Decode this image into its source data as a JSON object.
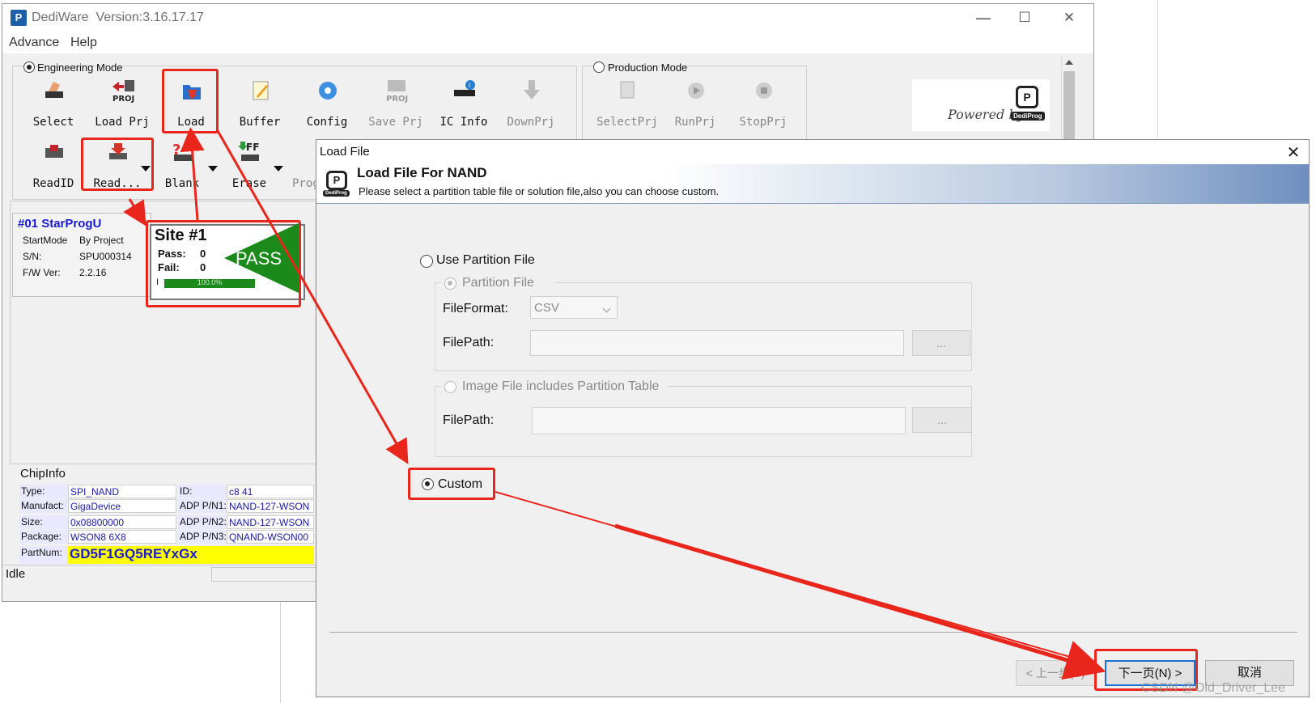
{
  "main_window": {
    "app_name": "DediWare",
    "version": "Version:3.16.17.17",
    "controls": {
      "minimize": "—",
      "maximize": "☐",
      "close": "✕"
    },
    "menu": [
      "Advance",
      "Help"
    ],
    "engineering_mode": "Engineering Mode",
    "production_mode": "Production Mode",
    "toolbar_row1": [
      "Select",
      "Load Prj",
      "Load",
      "Buffer",
      "Config",
      "Save Prj",
      "IC Info",
      "DownPrj"
    ],
    "toolbar_row2": [
      "ReadID",
      "Read...",
      "Blank",
      "Erase",
      "Prog"
    ],
    "production_tools": [
      "SelectPrj",
      "RunPrj",
      "StopPrj"
    ],
    "powered_by": "Powered by",
    "brand": "DediProg"
  },
  "programmer": {
    "title": "#01 StarProgU",
    "fields": [
      {
        "label": "StartMode",
        "value": "By Project"
      },
      {
        "label": "S/N:",
        "value": "SPU000314"
      },
      {
        "label": "F/W Ver:",
        "value": "2.2.16"
      }
    ]
  },
  "site": {
    "title": "Site #1",
    "pass_label": "Pass:",
    "pass_value": "0",
    "fail_label": "Fail:",
    "fail_value": "0",
    "result": "PASS",
    "progress_marker": "I",
    "progress_text": "100.0%",
    "progress": 1.0
  },
  "chip_info": {
    "title": "ChipInfo",
    "left": [
      {
        "label": "Type:",
        "value": "SPI_NAND"
      },
      {
        "label": "Manufact:",
        "value": "GigaDevice"
      },
      {
        "label": "Size:",
        "value": "0x08800000"
      },
      {
        "label": "Package:",
        "value": "WSON8 6X8"
      }
    ],
    "right": [
      {
        "label": "ID:",
        "value": "c8 41"
      },
      {
        "label": "ADP P/N1:",
        "value": "NAND-127-WSON"
      },
      {
        "label": "ADP P/N2:",
        "value": "NAND-127-WSON"
      },
      {
        "label": "ADP P/N3:",
        "value": "QNAND-WSON00"
      }
    ],
    "partnum_label": "PartNum:",
    "partnum_value": "GD5F1GQ5REYxGx"
  },
  "status": "Idle",
  "dialog": {
    "window_title": "Load File",
    "heading": "Load File For NAND",
    "subheading": "Please select a partition table file or solution file,also you can choose custom.",
    "use_partition_file": "Use Partition File",
    "partition_file": "Partition File",
    "file_format_label": "FileFormat:",
    "file_format_value": "CSV",
    "file_path_label": "FilePath:",
    "file_path_label2": "FilePath:",
    "browse_label": "...",
    "browse_label2": "...",
    "image_file_option": "Image File includes Partition Table",
    "custom_option": "Custom",
    "back_button": "< 上一步(B)",
    "next_button": "下一页(N) >",
    "cancel_button": "取消"
  },
  "watermark": "CSDN @Old_Driver_Lee",
  "annotation_color": "#e8261c"
}
